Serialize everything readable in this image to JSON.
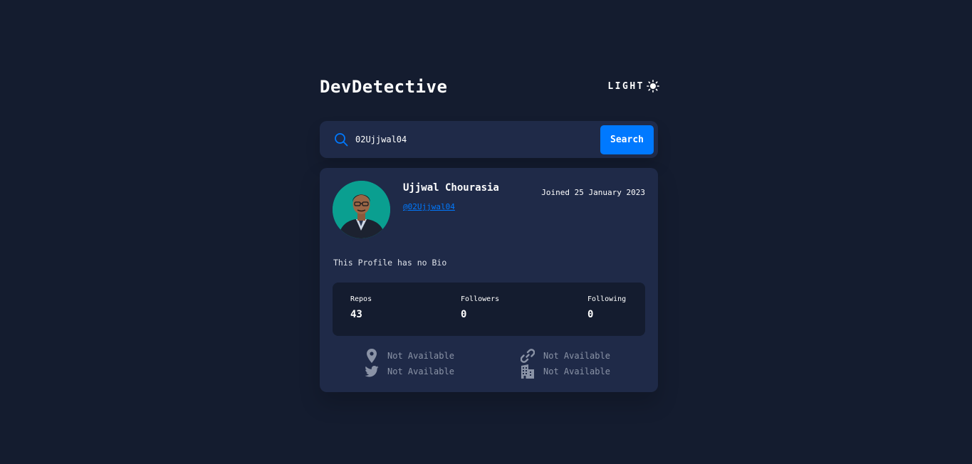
{
  "header": {
    "logo": "DevDetective",
    "theme_label": "LIGHT",
    "theme_icon": "sun-icon"
  },
  "search": {
    "icon": "search-icon",
    "value": "02Ujjwal04",
    "button_label": "Search"
  },
  "profile": {
    "name": "Ujjwal Chourasia",
    "handle": "@02Ujjwal04",
    "joined": "Joined 25 January 2023",
    "bio": "This Profile has no Bio",
    "stats": {
      "repos_label": "Repos",
      "repos_value": "43",
      "followers_label": "Followers",
      "followers_value": "0",
      "following_label": "Following",
      "following_value": "0"
    },
    "links": {
      "location": "Not Available",
      "website": "Not Available",
      "twitter": "Not Available",
      "company": "Not Available"
    }
  },
  "colors": {
    "background": "#141c2f",
    "card": "#1f2a48",
    "accent": "#0079ff",
    "muted": "#8a93a6"
  }
}
